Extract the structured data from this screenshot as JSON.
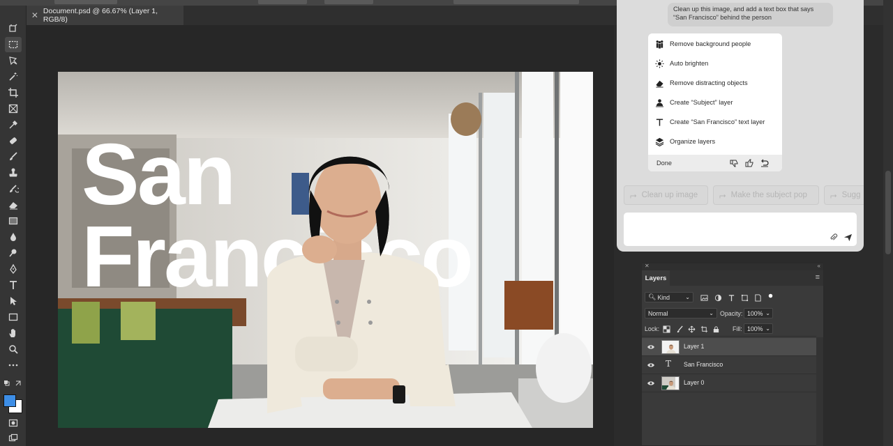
{
  "document": {
    "tab_title": "Document.psd @ 66.67% (Layer 1, RGB/8)",
    "close_symbol": "✕"
  },
  "canvas": {
    "headline_line1": "San",
    "headline_line2": "Francisco"
  },
  "assistant": {
    "user_message": "Clean up this image, and add a text box that says “San Francisco” behind the person",
    "steps": [
      {
        "label": "Remove background people",
        "icon": "people-icon"
      },
      {
        "label": "Auto brighten",
        "icon": "sun-icon"
      },
      {
        "label": "Remove distracting objects",
        "icon": "eraser-icon"
      },
      {
        "label": "Create “Subject” layer",
        "icon": "subject-icon"
      },
      {
        "label": "Create “San Francisco” text layer",
        "icon": "text-icon"
      },
      {
        "label": "Organize layers",
        "icon": "layers-icon"
      }
    ],
    "done_label": "Done",
    "suggestions": [
      {
        "label": "Clean up image"
      },
      {
        "label": "Make the subject pop"
      },
      {
        "label": "Sugg"
      }
    ],
    "prompt_placeholder": ""
  },
  "layers_panel": {
    "tab_label": "Layers",
    "filter_label": "Kind",
    "blend_mode": "Normal",
    "opacity_label": "Opacity:",
    "opacity_value": "100%",
    "lock_label": "Lock:",
    "fill_label": "Fill:",
    "fill_value": "100%",
    "layers": [
      {
        "name": "Layer 1",
        "type": "image",
        "selected": true
      },
      {
        "name": "San Francisco",
        "type": "text",
        "selected": false
      },
      {
        "name": "Layer 0",
        "type": "image",
        "selected": false
      }
    ]
  },
  "colors": {
    "foreground": "#3d8ee6",
    "background": "#ffffff",
    "panel": "#dcdcdc",
    "app_bg": "#2b2b2b"
  }
}
